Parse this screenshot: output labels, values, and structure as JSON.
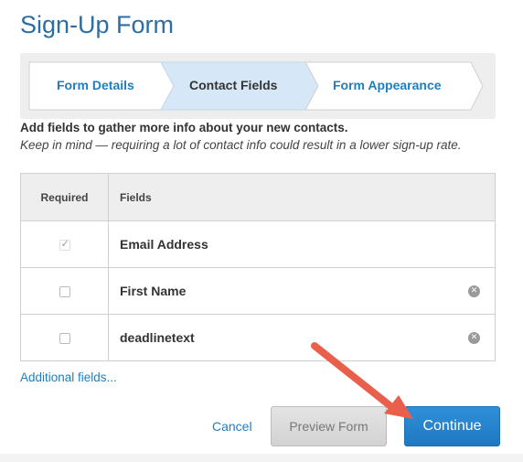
{
  "page": {
    "title": "Sign-Up Form"
  },
  "wizard": {
    "steps": [
      {
        "label": "Form Details",
        "active": false
      },
      {
        "label": "Contact Fields",
        "active": true
      },
      {
        "label": "Form Appearance",
        "active": false
      }
    ]
  },
  "intro": {
    "heading": "Add fields to gather more info about your new contacts.",
    "hint": "Keep in mind — requiring a lot of contact info could result in a lower sign-up rate."
  },
  "table": {
    "headers": {
      "required": "Required",
      "fields": "Fields"
    },
    "rows": [
      {
        "label": "Email Address",
        "required": true,
        "removable": false
      },
      {
        "label": "First Name",
        "required": false,
        "removable": true
      },
      {
        "label": "deadlinetext",
        "required": false,
        "removable": true
      }
    ]
  },
  "links": {
    "additional": "Additional fields..."
  },
  "actions": {
    "cancel": "Cancel",
    "preview": "Preview Form",
    "continue": "Continue"
  },
  "colors": {
    "brand": "#2b6ea3",
    "link": "#1f7ec0",
    "primary": "#1f78c2",
    "active_step": "#d6e8f7",
    "annotation_arrow": "#e8604c"
  }
}
